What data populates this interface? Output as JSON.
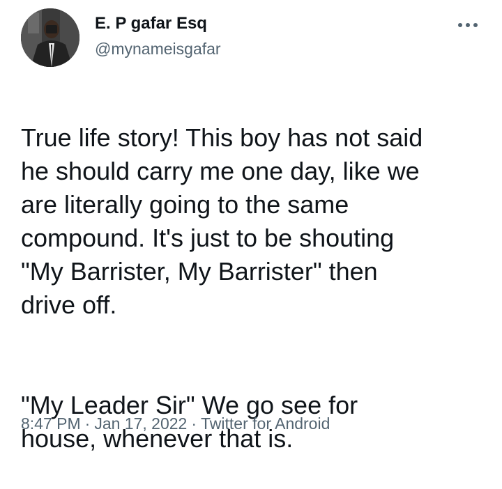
{
  "author": {
    "display_name": "E. P gafar Esq",
    "handle": "@mynameisgafar",
    "avatar_icon": "profile-photo"
  },
  "menu": {
    "icon": "more-horizontal-icon"
  },
  "tweet": {
    "text_line_1": "True life story! This boy has not said\nhe should carry me one day, like we\nare literally going to the same\ncompound.  It's just to be shouting\n\"My Barrister, My Barrister\" then\ndrive off.",
    "text_line_2": "\"My Leader Sir\" We go see for\nhouse, whenever that is."
  },
  "meta": {
    "time": "8:47 PM",
    "date": "Jan 17, 2022",
    "source": "Twitter for Android",
    "separator": "·"
  },
  "colors": {
    "text_primary": "#0f1419",
    "text_secondary": "#536471",
    "background": "#ffffff"
  }
}
